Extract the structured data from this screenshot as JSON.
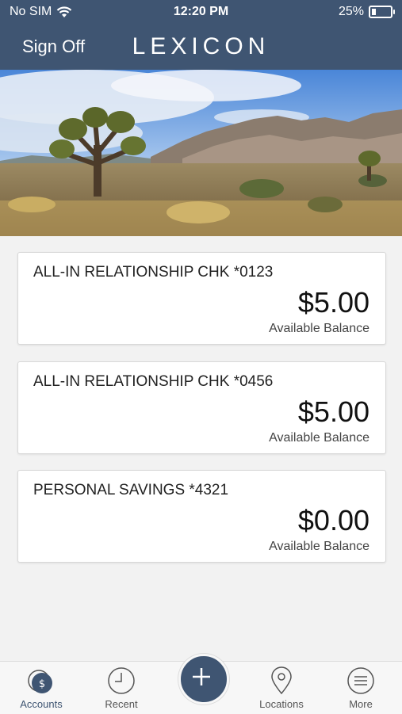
{
  "status_bar": {
    "carrier": "No SIM",
    "time": "12:20 PM",
    "battery": "25%",
    "battery_level": 0.25
  },
  "header": {
    "sign_off": "Sign Off",
    "logo": "LEXICON"
  },
  "accounts": [
    {
      "name": "ALL-IN RELATIONSHIP CHK *0123",
      "amount": "$5.00",
      "label": "Available Balance"
    },
    {
      "name": "ALL-IN RELATIONSHIP CHK *0456",
      "amount": "$5.00",
      "label": "Available Balance"
    },
    {
      "name": "PERSONAL SAVINGS *4321",
      "amount": "$0.00",
      "label": "Available Balance"
    }
  ],
  "tabbar": {
    "accounts": "Accounts",
    "recent": "Recent",
    "locations": "Locations",
    "more": "More"
  },
  "colors": {
    "brand": "#3f5572",
    "background": "#f2f2f2"
  }
}
